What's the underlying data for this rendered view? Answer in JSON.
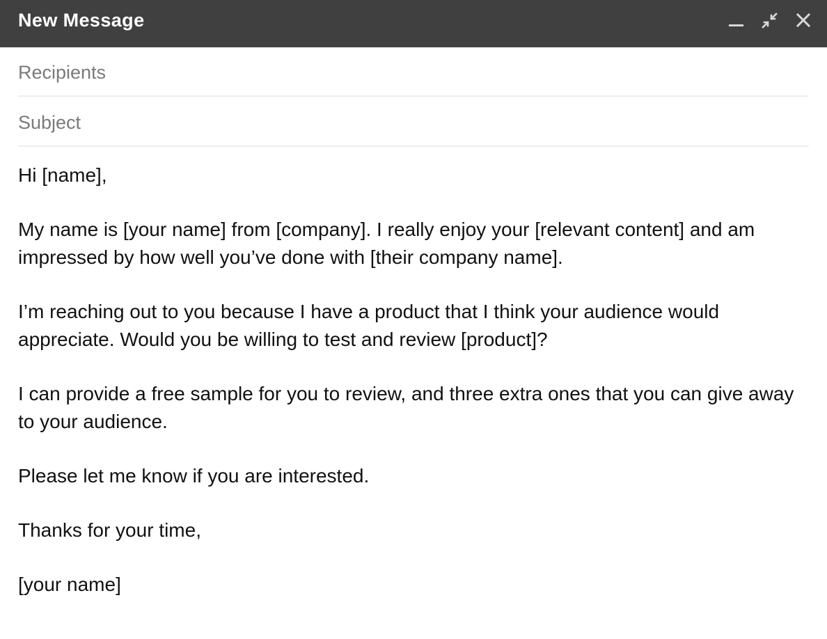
{
  "window": {
    "title": "New Message",
    "controls": {
      "minimize_icon": "minimize-icon",
      "exit_fullscreen_icon": "exit-fullscreen-icon",
      "close_icon": "close-icon"
    },
    "titlebar_color": "#404040"
  },
  "fields": {
    "recipients": {
      "placeholder": "Recipients",
      "value": ""
    },
    "subject": {
      "placeholder": "Subject",
      "value": ""
    }
  },
  "body": {
    "paragraphs": [
      "Hi [name],",
      "My name is [your name] from [company]. I really enjoy your [relevant content] and am impressed by how well you’ve done with [their company name].",
      "I’m reaching out to you because I have a product that I think your audience would appreciate. Would you be willing to test and review [product]?",
      "I can provide a free sample for you to review, and three extra ones that you can give away to your audience.",
      "Please let me know if you are interested.",
      "Thanks for your time,",
      "[your name]"
    ]
  }
}
